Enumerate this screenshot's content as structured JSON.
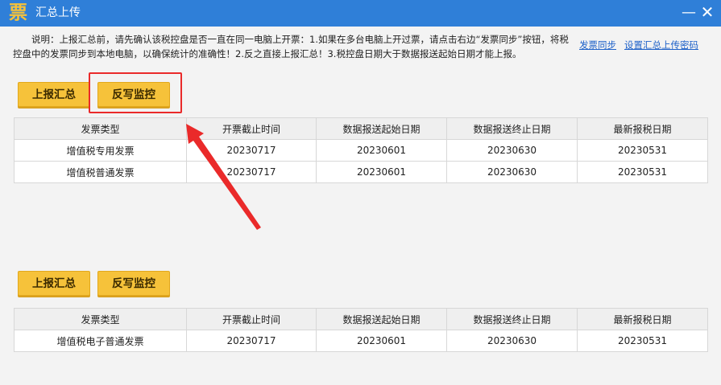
{
  "window": {
    "title": "汇总上传",
    "logo_glyph": "票",
    "minimize_glyph": "—",
    "close_glyph": "✕"
  },
  "notice": "说明：上报汇总前，请先确认该税控盘是否一直在同一电脑上开票：1.如果在多台电脑上开过票，请点击右边“发票同步”按钮，将税控盘中的发票同步到本地电脑，以确保统计的准确性！2.反之直接上报汇总！3.税控盘日期大于数据报送起始日期才能上报。",
  "links": {
    "sync": "发票同步",
    "set_password": "设置汇总上传密码"
  },
  "section1": {
    "report_button": "上报汇总",
    "monitor_button": "反写监控",
    "columns": [
      "发票类型",
      "开票截止时间",
      "数据报送起始日期",
      "数据报送终止日期",
      "最新报税日期"
    ],
    "rows": [
      [
        "增值税专用发票",
        "20230717",
        "20230601",
        "20230630",
        "20230531"
      ],
      [
        "增值税普通发票",
        "20230717",
        "20230601",
        "20230630",
        "20230531"
      ]
    ]
  },
  "section2": {
    "report_button": "上报汇总",
    "monitor_button": "反写监控",
    "columns": [
      "发票类型",
      "开票截止时间",
      "数据报送起始日期",
      "数据报送终止日期",
      "最新报税日期"
    ],
    "rows": [
      [
        "增值税电子普通发票",
        "20230717",
        "20230601",
        "20230630",
        "20230531"
      ]
    ]
  },
  "colors": {
    "titlebar": "#2f7fd8",
    "button": "#f6c23a",
    "annotation": "#ea2a2a",
    "link": "#1f62c9"
  }
}
